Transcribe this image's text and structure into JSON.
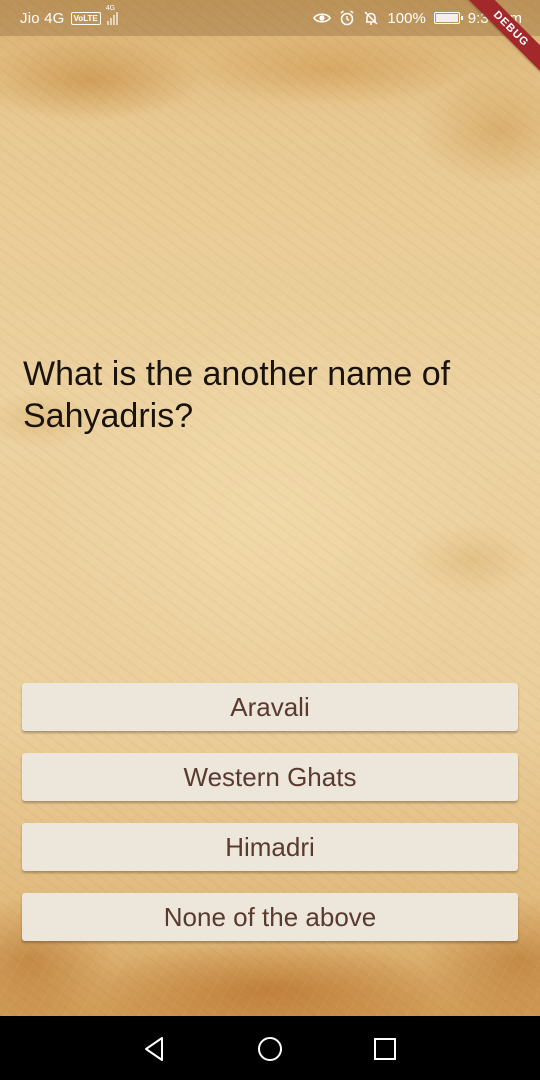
{
  "status_bar": {
    "carrier": "Jio 4G",
    "volte": "VoLTE",
    "network": "4G",
    "battery": "100%",
    "time": "9:34 pm",
    "icons": [
      "eye-icon",
      "alarm-icon",
      "bell-off-icon",
      "battery-icon"
    ]
  },
  "debug_banner": "DEBUG",
  "quiz": {
    "question": "What is the another name of Sahyadris?",
    "answers": [
      {
        "label": "Aravali"
      },
      {
        "label": "Western Ghats"
      },
      {
        "label": "Himadri"
      },
      {
        "label": "None of the above"
      }
    ]
  },
  "nav_bar": {
    "buttons": [
      "back-icon",
      "home-icon",
      "recents-icon"
    ]
  },
  "colors": {
    "parchment": "#e6c590",
    "question_text": "#1a130c",
    "button_bg": "#ede6da",
    "button_text": "#5a3a2f",
    "debug_banner": "#a3282b",
    "nav_bar": "#000000"
  }
}
